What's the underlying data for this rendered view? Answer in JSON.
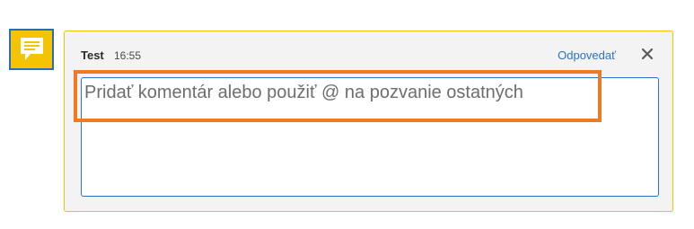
{
  "comment": {
    "author": "Test",
    "time": "16:55",
    "reply_label": "Odpovedať",
    "input_placeholder": "Pridať komentár alebo použiť @ na pozvanie ostatných"
  },
  "icons": {
    "marker": "comment-note-icon",
    "close": "close-icon"
  },
  "colors": {
    "marker_fill": "#f5c400",
    "marker_border": "#2b6cb4",
    "panel_border": "#f2c200",
    "link": "#2a72c5",
    "highlight": "#ee7a22"
  }
}
